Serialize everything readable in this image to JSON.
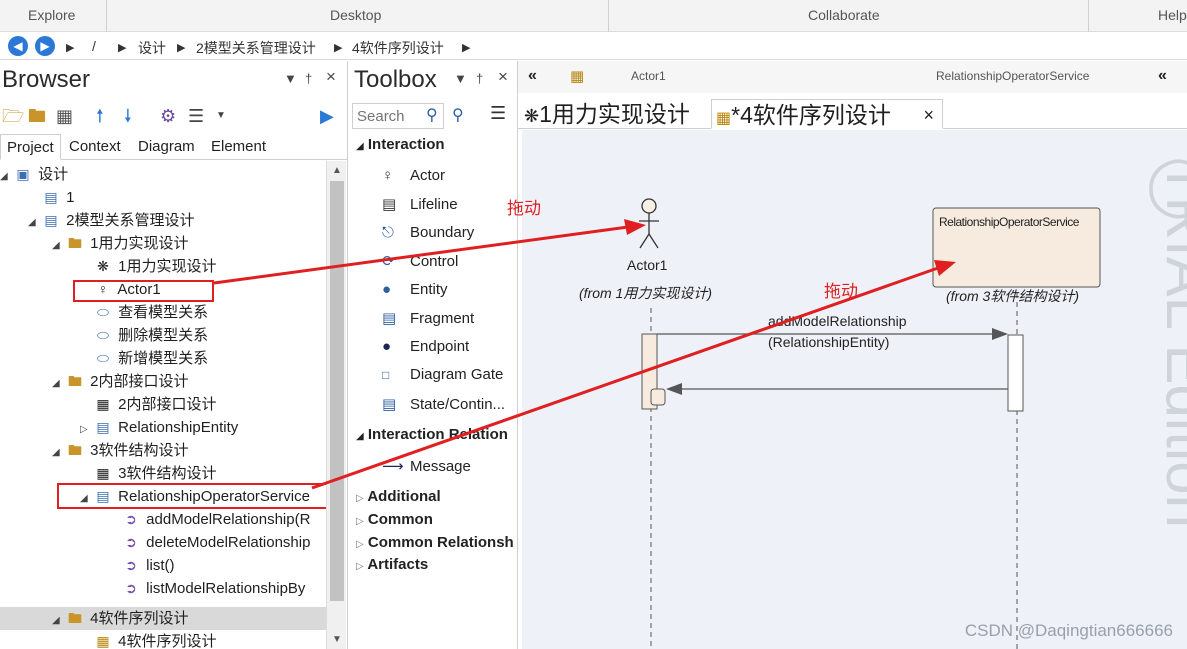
{
  "ribbon": {
    "items": [
      "Explore",
      "Desktop",
      "Collaborate",
      "Help"
    ]
  },
  "breadcrumb": {
    "root_sep": "/",
    "items": [
      "设计",
      "2模型关系管理设计",
      "4软件序列设计"
    ]
  },
  "browser": {
    "title": "Browser",
    "pin": "↓ †",
    "close": "×",
    "tabs": [
      "Project",
      "Context",
      "Diagram",
      "Element"
    ],
    "tree": [
      {
        "label": "设计",
        "icon": "package-root-icon",
        "expanded": true
      },
      {
        "label": "1",
        "icon": "model-icon"
      },
      {
        "label": "2模型关系管理设计",
        "icon": "model-icon",
        "expanded": true
      },
      {
        "label": "1用力实现设计",
        "icon": "folder-icon",
        "expanded": true
      },
      {
        "label": "1用力实现设计",
        "icon": "usecase-diagram-icon"
      },
      {
        "label": "Actor1",
        "icon": "actor-icon"
      },
      {
        "label": "查看模型关系",
        "icon": "usecase-icon"
      },
      {
        "label": "删除模型关系",
        "icon": "usecase-icon"
      },
      {
        "label": "新增模型关系",
        "icon": "usecase-icon"
      },
      {
        "label": "2内部接口设计",
        "icon": "folder-icon",
        "expanded": true
      },
      {
        "label": "2内部接口设计",
        "icon": "component-diagram-icon"
      },
      {
        "label": "RelationshipEntity",
        "icon": "class-icon",
        "expanded": false
      },
      {
        "label": "3软件结构设计",
        "icon": "folder-icon",
        "expanded": true
      },
      {
        "label": "3软件结构设计",
        "icon": "component-diagram-icon"
      },
      {
        "label": "RelationshipOperatorService",
        "icon": "class-icon",
        "expanded": true
      },
      {
        "label": "addModelRelationship(R",
        "icon": "operation-icon"
      },
      {
        "label": "deleteModelRelationship",
        "icon": "operation-icon"
      },
      {
        "label": "list()",
        "icon": "operation-icon"
      },
      {
        "label": "listModelRelationshipBy",
        "icon": "operation-icon"
      },
      {
        "label": "4软件序列设计",
        "icon": "folder-icon",
        "expanded": true
      },
      {
        "label": "4软件序列设计",
        "icon": "sequence-diagram-icon"
      }
    ]
  },
  "toolbox": {
    "title": "Toolbox",
    "close": "×",
    "search_placeholder": "Search",
    "interaction_group": "Interaction",
    "interaction_items": [
      {
        "label": "Actor",
        "icon": "actor-icon"
      },
      {
        "label": "Lifeline",
        "icon": "lifeline-icon"
      },
      {
        "label": "Boundary",
        "icon": "boundary-icon"
      },
      {
        "label": "Control",
        "icon": "control-icon"
      },
      {
        "label": "Entity",
        "icon": "entity-icon"
      },
      {
        "label": "Fragment",
        "icon": "fragment-icon"
      },
      {
        "label": "Endpoint",
        "icon": "endpoint-icon"
      },
      {
        "label": "Diagram Gate",
        "icon": "gate-icon"
      },
      {
        "label": "State/Contin...",
        "icon": "state-icon"
      }
    ],
    "relation_group": "Interaction Relation",
    "relation_items": [
      {
        "label": "Message",
        "icon": "message-arrow-icon"
      }
    ],
    "collapsed_groups": [
      "Additional",
      "Common",
      "Common Relationsh",
      "Artifacts"
    ]
  },
  "diagram": {
    "header_left": "Actor1",
    "header_right": "RelationshipOperatorService",
    "tabs": [
      {
        "label": "1用力实现设计",
        "icon": "usecase-diagram-icon"
      },
      {
        "label": "*4软件序列设计",
        "icon": "sequence-diagram-icon",
        "active": true
      }
    ],
    "close": "×",
    "watermark": "TRIAL Edition",
    "actor_name": "Actor1",
    "actor_from": "(from 1用力实现设计)",
    "service_name": "RelationshipOperatorService",
    "service_from": "(from 3软件结构设计)",
    "message_line1": "addModelRelationship",
    "message_line2": "(RelationshipEntity)",
    "annotation1": "拖动",
    "annotation2": "拖动",
    "credit": "CSDN @Daqingtian666666"
  },
  "colors": {
    "accent": "#2b78d6",
    "annotation": "#e02020",
    "canvas": "#eef2f8"
  }
}
